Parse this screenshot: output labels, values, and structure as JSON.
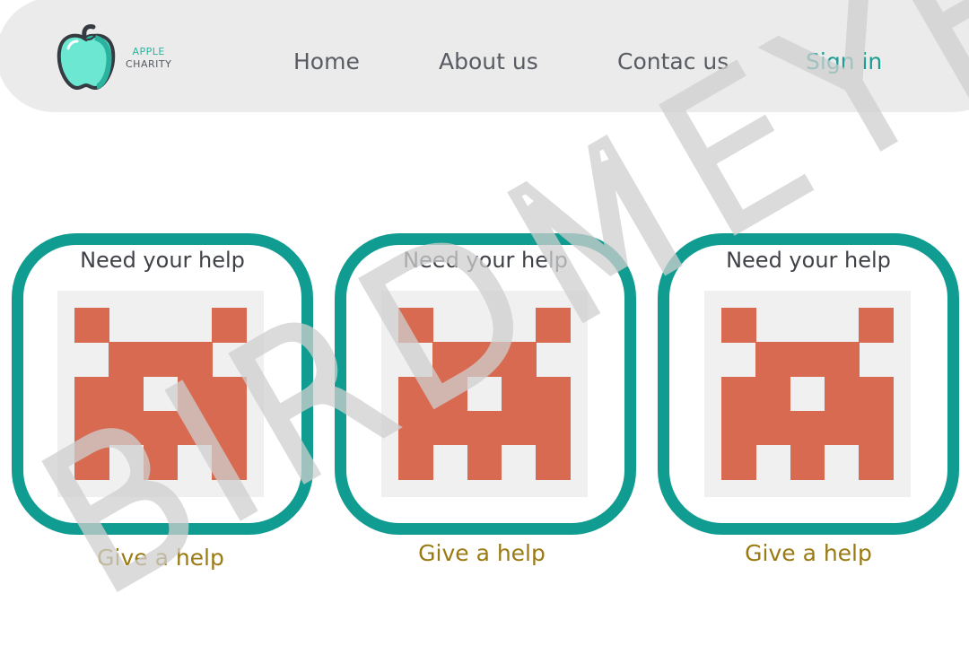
{
  "logo": {
    "line1": "APPLE",
    "line2": "CHARITY",
    "icon": "apple-icon"
  },
  "nav": {
    "home": "Home",
    "about": "About us",
    "contact": "Contac us",
    "signin": "Sign in"
  },
  "cards": [
    {
      "heading": "Need your help",
      "image": "space-invader-icon",
      "action": "Give a help"
    },
    {
      "heading": "Need your help",
      "image": "space-invader-icon",
      "action": "Give a help"
    },
    {
      "heading": "Need your help",
      "image": "space-invader-icon",
      "action": "Give a help"
    }
  ],
  "colors": {
    "accent": "#119c91",
    "header_bg": "#ebebeb",
    "invader": "#d76a50",
    "action_text": "#9a7a12",
    "watermark": "#cfcfcf"
  },
  "watermark": {
    "text": "BIRDMEYEW"
  }
}
